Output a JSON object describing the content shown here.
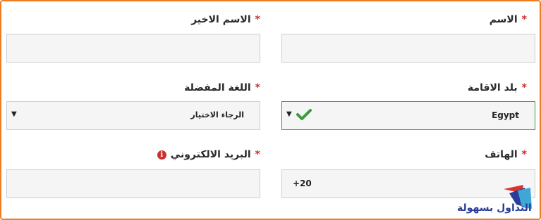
{
  "form": {
    "first_name": {
      "label": "الاسم",
      "required_mark": "*",
      "value": ""
    },
    "last_name": {
      "label": "الاسم الاخير",
      "required_mark": "*",
      "value": ""
    },
    "country": {
      "label": "بلد الاقامة",
      "required_mark": "*",
      "value": "Egypt",
      "valid": true
    },
    "language": {
      "label": "اللغة المفضلة",
      "required_mark": "*",
      "value": "الرجاء الاختيار"
    },
    "phone": {
      "label": "الهاتف",
      "required_mark": "*",
      "value": "+20"
    },
    "email": {
      "label": "البريد الالكتروني",
      "required_mark": "*",
      "value": "",
      "info_icon": "i"
    }
  },
  "watermark": {
    "text": "التداول بسهولة"
  },
  "colors": {
    "frame": "#f07d24",
    "required": "#cc2b2b",
    "valid": "#3a9b3a"
  },
  "icons": [
    "check-icon",
    "dropdown-caret-icon",
    "info-icon",
    "logo-icon"
  ]
}
